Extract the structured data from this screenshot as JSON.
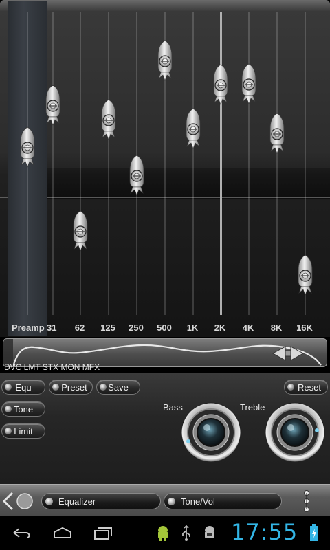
{
  "equalizer": {
    "bands": [
      {
        "label": "Preamp"
      },
      {
        "label": "31"
      },
      {
        "label": "62"
      },
      {
        "label": "125"
      },
      {
        "label": "250"
      },
      {
        "label": "500"
      },
      {
        "label": "1K"
      },
      {
        "label": "2K"
      },
      {
        "label": "4K"
      },
      {
        "label": "8K"
      },
      {
        "label": "16K"
      }
    ]
  },
  "flags_text": "DVC LMT STX MON MFX",
  "controls": {
    "equ_label": "Equ",
    "preset_label": "Preset",
    "save_label": "Save",
    "reset_label": "Reset",
    "tone_label": "Tone",
    "limit_label": "Limit",
    "bass_label": "Bass",
    "treble_label": "Treble"
  },
  "bottom_bar": {
    "equalizer_tab": "Equalizer",
    "tonevol_tab": "Tone/Vol"
  },
  "system": {
    "clock": "17:55",
    "accent_color": "#33b5e5"
  }
}
